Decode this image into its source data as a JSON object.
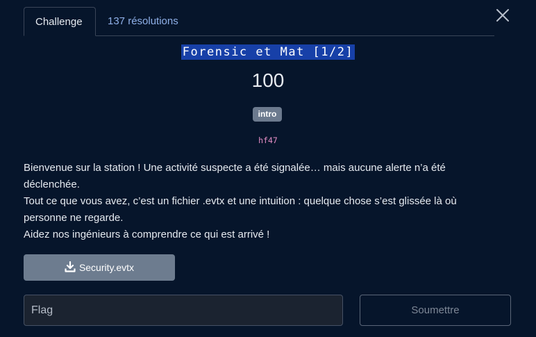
{
  "tabs": {
    "challenge_label": "Challenge",
    "solves_label": "137 résolutions"
  },
  "challenge": {
    "title": "Forensic et Mat [1/2]",
    "points": "100",
    "tag": "intro",
    "author": "hf47",
    "description": [
      "Bienvenue sur la station ! Une activité suspecte a été signalée… mais aucune alerte n’a été déclenchée.",
      "Tout ce que vous avez, c’est un fichier .evtx et une intuition : quelque chose s’est glissée là où personne ne regarde.",
      "Aidez nos ingénieurs à comprendre ce qui est arrivé !"
    ],
    "file_label": "Security.evtx"
  },
  "form": {
    "flag_placeholder": "Flag",
    "flag_value": "",
    "submit_label": "Soumettre"
  },
  "icons": {
    "close": "close-icon",
    "download": "download-icon"
  }
}
